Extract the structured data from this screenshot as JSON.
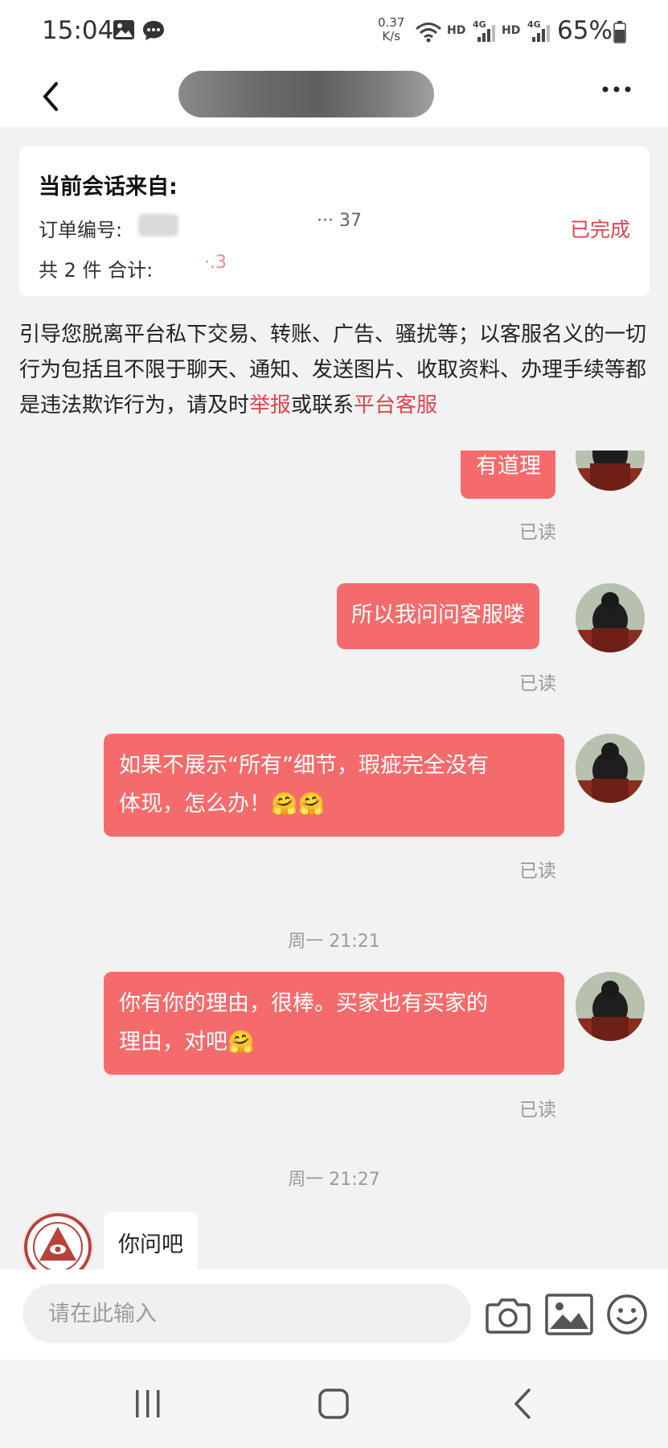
{
  "status_bar": {
    "time": "15:04",
    "speed_value": "0.37",
    "speed_unit": "K/s",
    "hd1": "HD",
    "net1": "4G",
    "hd2": "HD",
    "net2": "4G",
    "battery": "65%"
  },
  "nav": {
    "back_icon": "chevron-left-icon",
    "more_icon": "more-horizontal-icon"
  },
  "order_card": {
    "heading": "当前会话来自:",
    "order_no_label": "订单编号:",
    "order_no_partial": "··· 37",
    "status": "已完成",
    "summary_label": "共 2 件 合计:",
    "summary_partial": "·.3"
  },
  "warning": {
    "text_main": "引导您脱离平台私下交易、转账、广告、骚扰等；以客服名义的一切行为包括且不限于聊天、通知、发送图片、收取资料、办理手续等都是违法欺诈行为，请及时",
    "link_report": "举报",
    "text_or": "或联系",
    "link_service": "平台客服"
  },
  "messages": [
    {
      "from": "me",
      "text": "有道理",
      "status": "已读"
    },
    {
      "from": "me",
      "text": "所以我问问客服喽",
      "status": "已读"
    },
    {
      "from": "me",
      "text_line1": "如果不展示“所有”细节，瑕疵完全没有",
      "text_line2": "体现，怎么办！🤗🤗",
      "status": "已读"
    },
    {
      "type": "timestamp",
      "text": "周一 21:21"
    },
    {
      "from": "me",
      "text_line1": "你有你的理由，很棒。买家也有买家的",
      "text_line2": "理由，对吧🤗",
      "status": "已读"
    },
    {
      "type": "timestamp",
      "text": "周一 21:27"
    },
    {
      "from": "them",
      "text": "你问吧"
    }
  ],
  "input_bar": {
    "placeholder": "请在此输入",
    "camera_icon": "camera-icon",
    "image_icon": "image-icon",
    "emoji_icon": "smiley-icon"
  },
  "system_nav": {
    "recents_icon": "recents-icon",
    "home_icon": "home-icon",
    "back_icon": "back-icon"
  },
  "colors": {
    "accent": "#e0454f",
    "bubble_me": "#f56b6b"
  }
}
